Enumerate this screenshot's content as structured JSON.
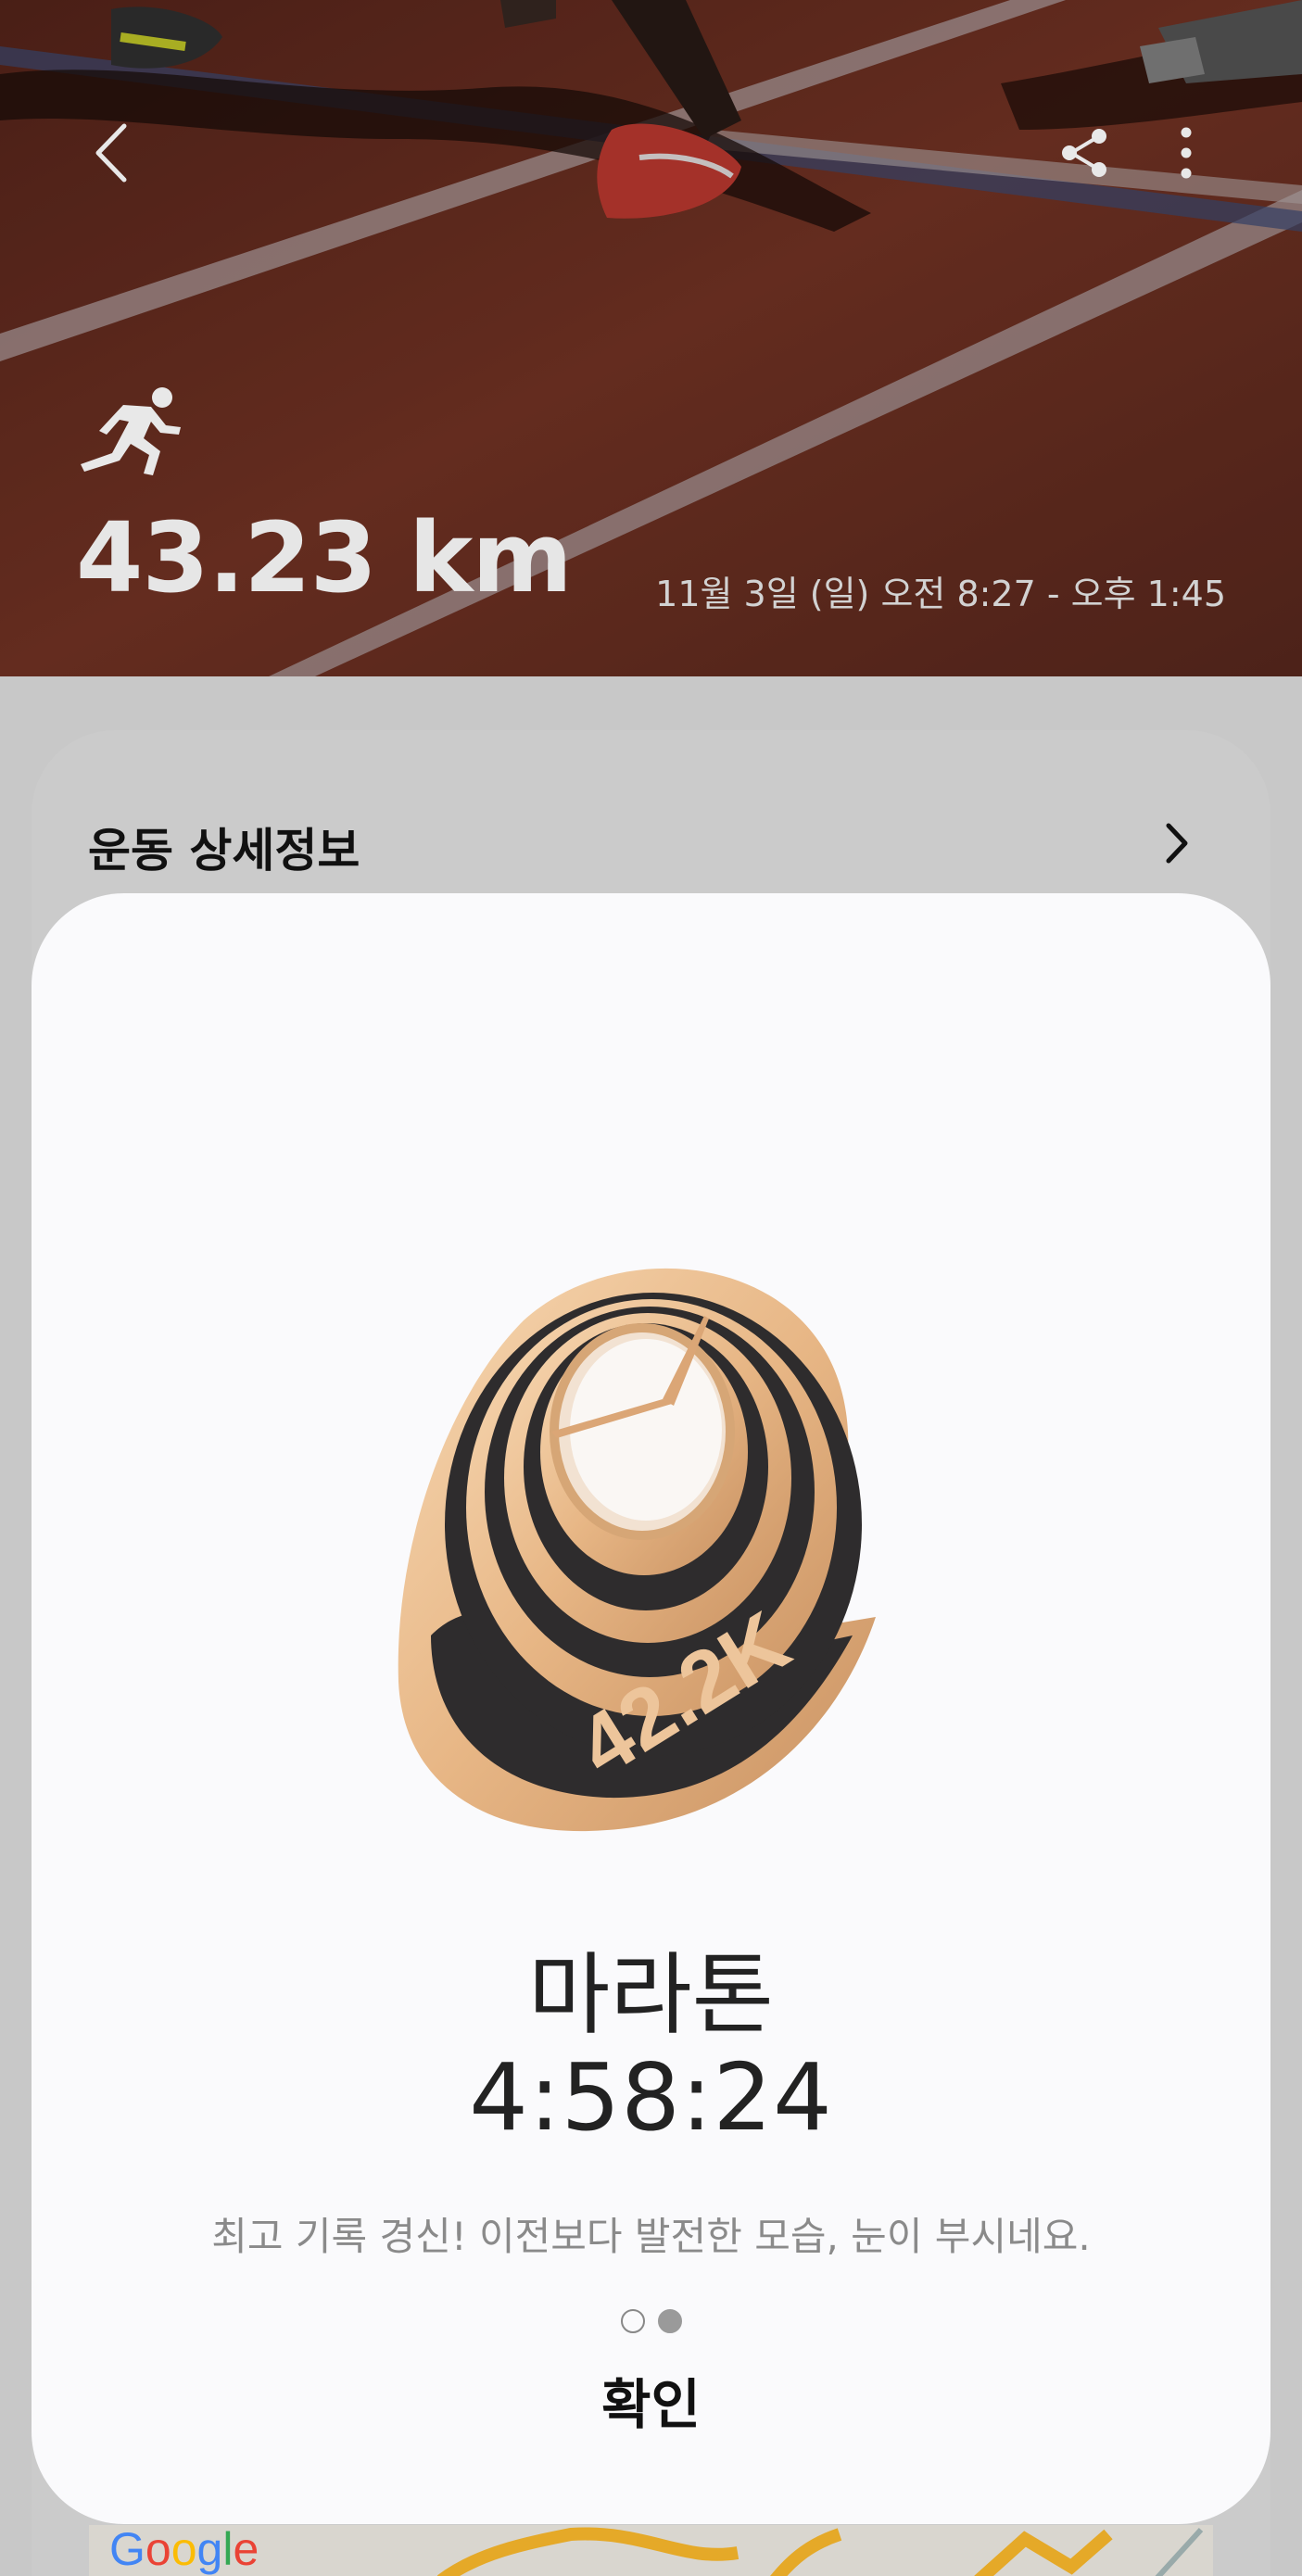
{
  "hero": {
    "distance": "43.23 km",
    "date_range": "11월 3일 (일) 오전 8:27 - 오후 1:45"
  },
  "details_card": {
    "title": "운동 상세정보"
  },
  "modal": {
    "badge_label": "42.2K",
    "title": "마라톤",
    "time": "4:58:24",
    "message": "최고 기록 경신! 이전보다 발전한 모습, 눈이 부시네요.",
    "page_count": 2,
    "current_page": 2,
    "confirm_label": "확인"
  },
  "map": {
    "logo_text": "Google"
  },
  "icons": {
    "back": "chevron-left-icon",
    "share": "share-icon",
    "more": "more-vertical-icon",
    "activity": "running-icon",
    "detail": "chevron-right-icon"
  },
  "colors": {
    "badge_gold": "#e8b98a",
    "badge_dark": "#2e2c2d",
    "track": "#6e2f22"
  }
}
